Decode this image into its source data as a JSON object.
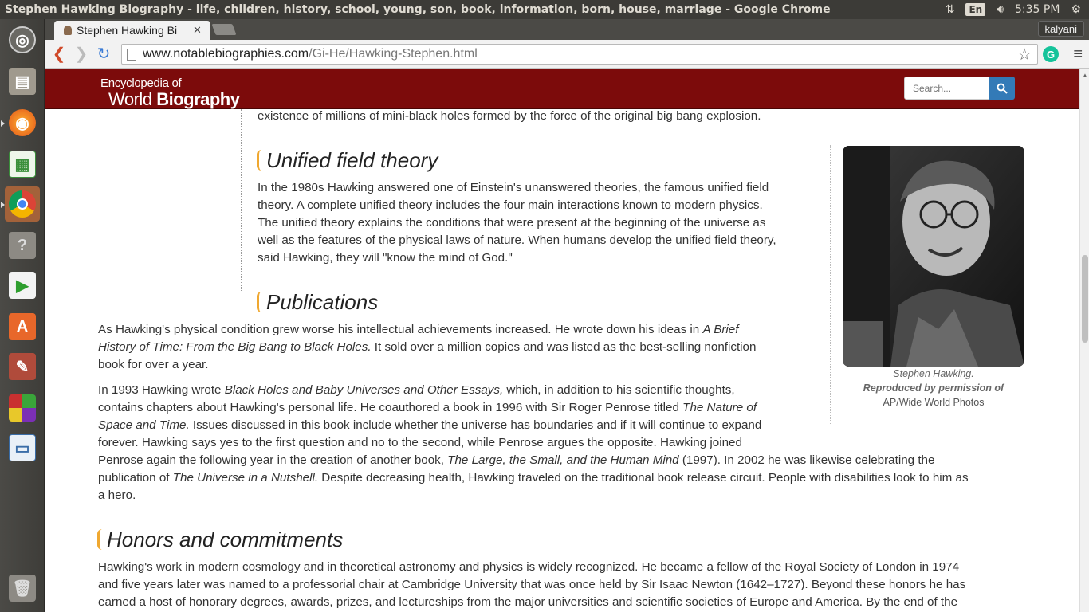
{
  "window_title": "Stephen Hawking Biography - life, children, history, school, young, son, book, information, born, house, marriage - Google Chrome",
  "panel": {
    "lang": "En",
    "time": "5:35 PM"
  },
  "browser": {
    "tab_label": "Stephen Hawking Bi",
    "user": "kalyani",
    "url_host": "www.notablebiographies.com",
    "url_path": "/Gi-He/Hawking-Stephen.html"
  },
  "site": {
    "logo_top": "Encyclopedia of",
    "logo_word1": "World",
    "logo_word2": "Biography",
    "search_placeholder": "Search..."
  },
  "article": {
    "intro_tail": "existence of millions of mini-black holes formed by the force of the original big bang explosion.",
    "sec1_title": "Unified field theory",
    "sec1_lines": [
      "In the 1980s Hawking answered one of Einstein's unanswered theories, the famous unified field",
      "theory. A complete unified theory includes the four main interactions known to modern physics.",
      "The unified theory explains the conditions that were present at the beginning of the universe as",
      "well as the features of the physical laws of nature. When humans develop the unified field theory,",
      "said Hawking, they will \"know the mind of God.\""
    ],
    "sec2_title": "Publications",
    "pub1": {
      "l1a": "As Hawking's physical condition grew worse his intellectual achievements increased. He wrote down his ideas in ",
      "l1b": "A Brief",
      "l2a": "History of Time: From the Big Bang to Black Holes.",
      "l2b": " It sold over a million copies and was listed as the best-selling nonfiction",
      "l3": "book for over a year."
    },
    "pub2": {
      "l1a": "In 1993 Hawking wrote ",
      "l1b": "Black Holes and Baby Universes and Other Essays,",
      "l1c": " which, in addition to his scientific thoughts,",
      "l2a": "contains chapters about Hawking's personal life. He coauthored a book in 1996 with Sir Roger Penrose titled ",
      "l2b": "The Nature of",
      "l3a": "Space and Time.",
      "l3b": " Issues discussed in this book include whether the universe has boundaries and if it will continue to expand",
      "l4": "forever. Hawking says yes to the first question and no to the second, while Penrose argues the opposite. Hawking joined",
      "l5a": "Penrose again the following year in the creation of another book, ",
      "l5b": "The Large, the Small, and the Human Mind",
      "l5c": " (1997). In 2002 he was likewise celebrating the",
      "l6a": "publication of ",
      "l6b": "The Universe in a Nutshell.",
      "l6c": " Despite decreasing health, Hawking traveled on the traditional book release circuit. People with disabilities look to him as",
      "l7": "a hero."
    },
    "sec3_title": "Honors and commitments",
    "honors_lines": [
      "Hawking's work in modern cosmology and in theoretical astronomy and physics is widely recognized. He became a fellow of the Royal Society of London in 1974",
      "and five years later was named to a professorial chair at Cambridge University that was once held by Sir Isaac Newton (1642–1727). Beyond these honors he has",
      "earned a host of honorary degrees, awards, prizes, and lectureships from the major universities and scientific societies of Europe and America. By the end of the"
    ],
    "caption": {
      "line1": "Stephen Hawking.",
      "line2": "Reproduced by permission of",
      "line3": "AP/Wide World Photos"
    }
  }
}
